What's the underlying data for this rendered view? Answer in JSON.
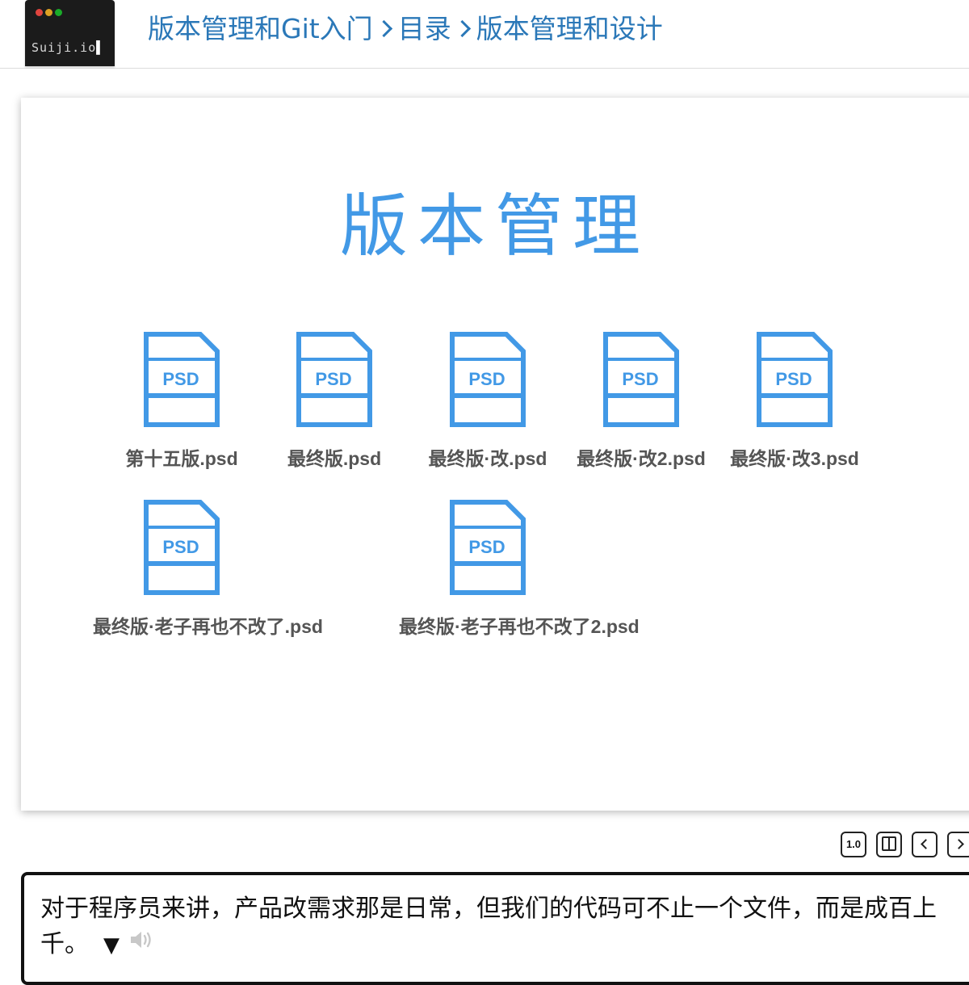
{
  "header": {
    "logo": {
      "text": "Suiji.io",
      "caret": "▌",
      "dot_colors": [
        "#e0443e",
        "#dea123",
        "#1aab29"
      ]
    },
    "breadcrumb": [
      "版本管理和Git入门",
      "目录",
      "版本管理和设计"
    ]
  },
  "slide": {
    "title": "版本管理",
    "icon_label": "PSD",
    "accent_color": "#4299e6",
    "files": [
      {
        "name": "第十五版.psd"
      },
      {
        "name": "最终版.psd"
      },
      {
        "name": "最终版·改.psd"
      },
      {
        "name": "最终版·改2.psd"
      },
      {
        "name": "最终版·改3.psd"
      },
      {
        "name": "最终版·老子再也不改了.psd"
      },
      {
        "name": "最终版·老子再也不改了2.psd"
      }
    ]
  },
  "controls": {
    "speed_label": "1.0",
    "buttons": [
      "speed",
      "panel-toggle-icon",
      "prev-chevron-icon",
      "next-chevron-icon"
    ]
  },
  "subtitle": {
    "text": "对于程序员来讲，产品改需求那是日常，但我们的代码可不止一个文件，而是成百上千。",
    "arrow": "▼",
    "speaker_icon": "speaker-icon"
  }
}
